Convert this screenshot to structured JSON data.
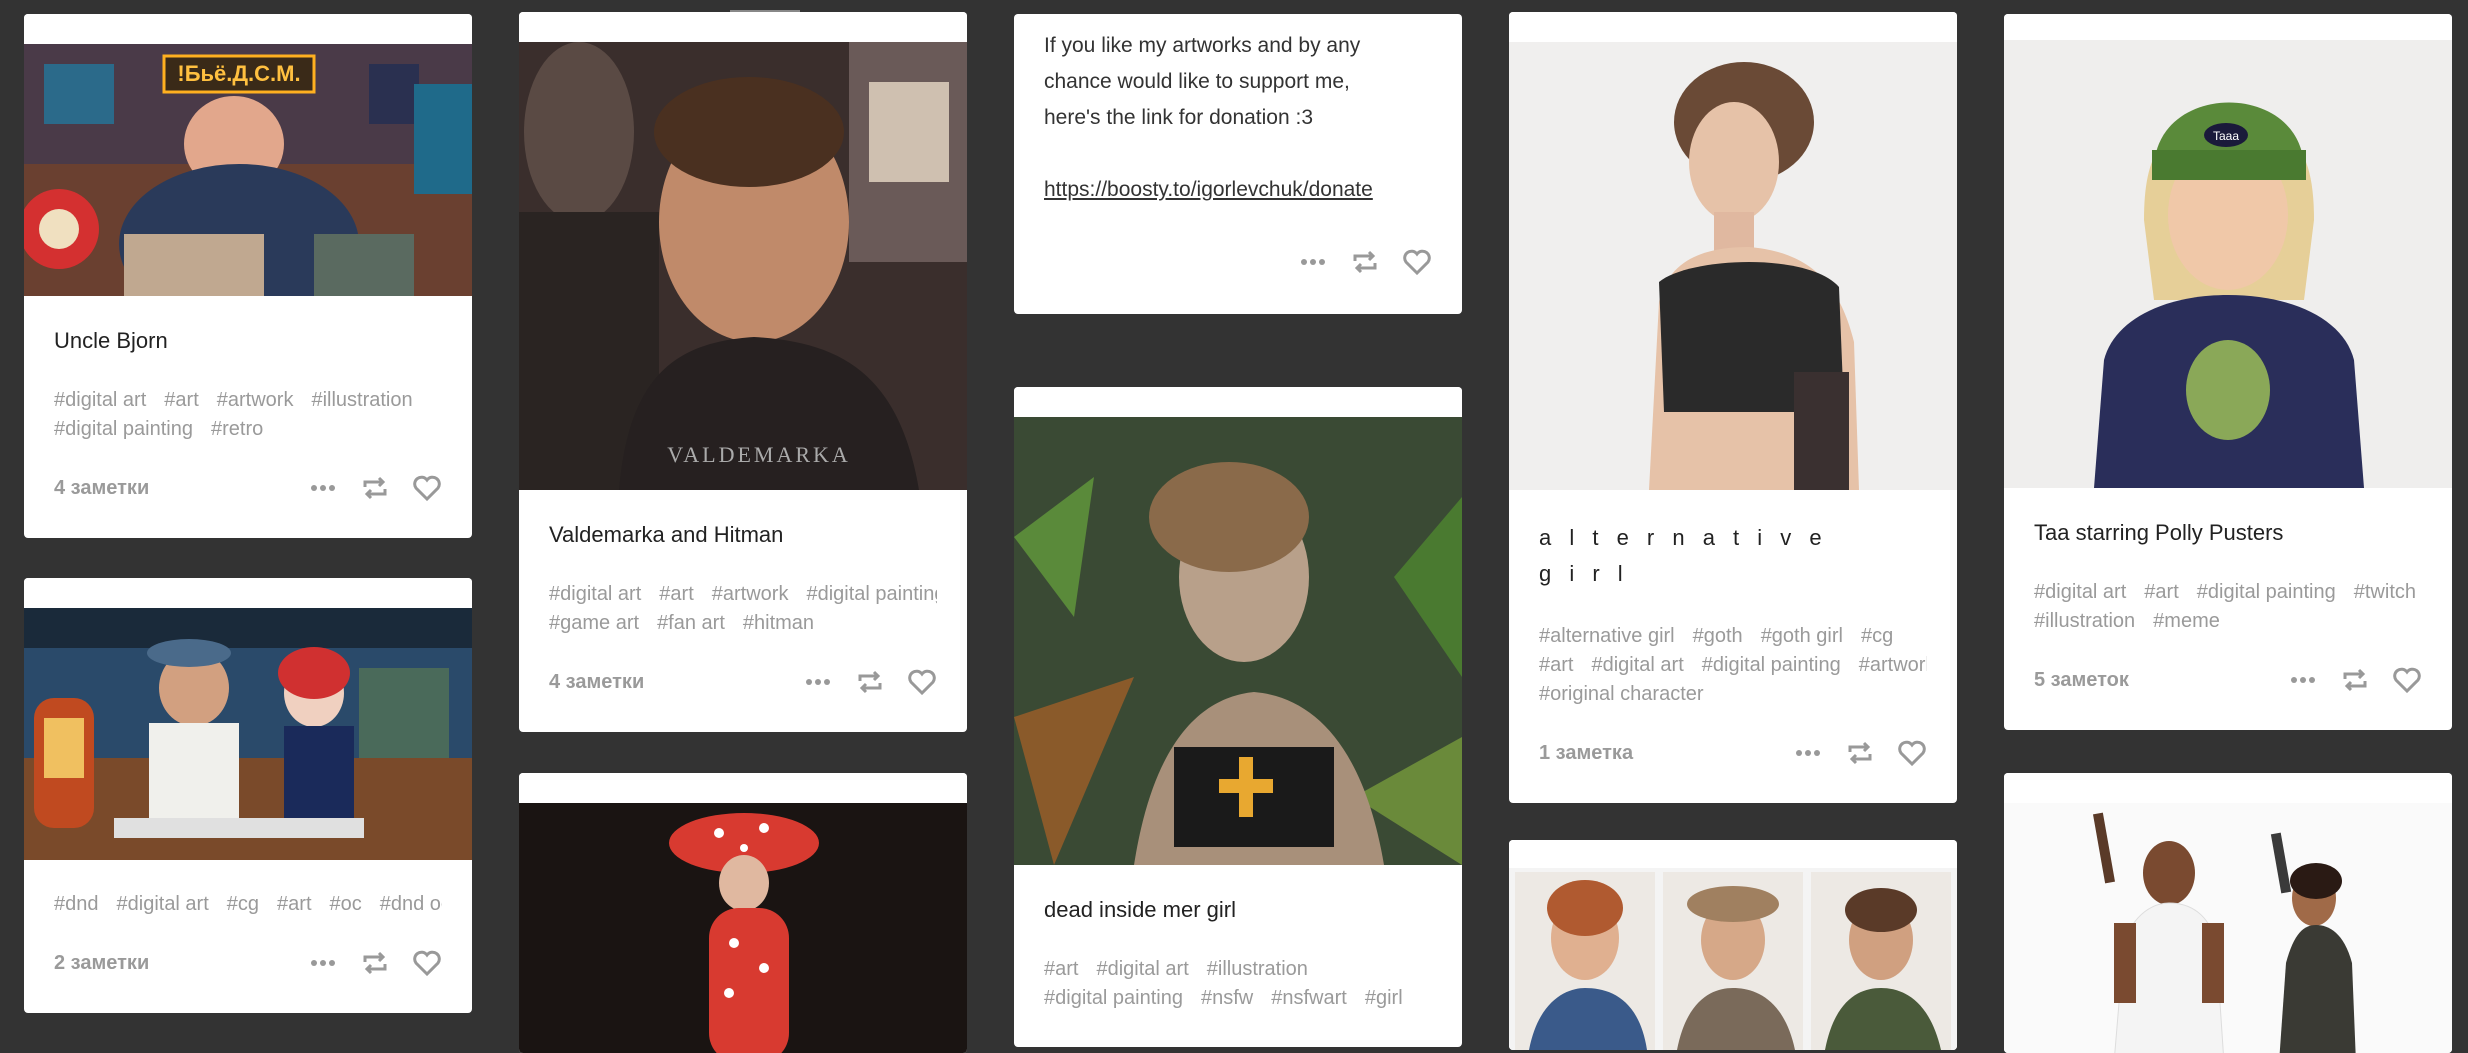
{
  "cards": {
    "uncle": {
      "title": "Uncle Bjorn",
      "sign_text": "!Бьё.Д.С.М.",
      "tags": [
        "#digital art",
        "#art",
        "#artwork",
        "#illustration"
      ],
      "tags2": [
        "#digital painting",
        "#retro"
      ],
      "notes": "4 заметки"
    },
    "dnd": {
      "tags": [
        "#dnd",
        "#digital art",
        "#cg",
        "#art",
        "#oc",
        "#dnd oc"
      ],
      "notes": "2 заметки"
    },
    "valdemarka": {
      "title": "Valdemarka and Hitman",
      "shirt_text": "VALDEMARKA",
      "tags": [
        "#digital art",
        "#art",
        "#artwork",
        "#digital painting"
      ],
      "tags2": [
        "#game art",
        "#fan art",
        "#hitman"
      ],
      "notes": "4 заметки"
    },
    "donation": {
      "text1": "If you like my artworks and by any",
      "text2": "chance would like to support me,",
      "text3": "here's the link for donation :3",
      "link": "https://boosty.to/igorlevchuk/donate"
    },
    "mermaid": {
      "title": "dead inside mer girl",
      "tags": [
        "#art",
        "#digital art",
        "#illustration"
      ],
      "tags2": [
        "#digital painting",
        "#nsfw",
        "#nsfwart",
        "#girl"
      ]
    },
    "altgirl": {
      "title": "a l t e r n a t i v e\ng i r l",
      "tags": [
        "#alternative girl",
        "#goth",
        "#goth girl",
        "#cg"
      ],
      "tags2": [
        "#art",
        "#digital art",
        "#digital painting",
        "#artwork"
      ],
      "tags3": [
        "#original character"
      ],
      "notes": "1 заметка"
    },
    "taa": {
      "title": "Taa starring Polly Pusters",
      "hat_text": "Taaa",
      "tags": [
        "#digital art",
        "#art",
        "#digital painting",
        "#twitch"
      ],
      "tags2": [
        "#illustration",
        "#meme"
      ],
      "notes": "5 заметок"
    }
  },
  "icons": {
    "more": "more-icon",
    "reblog": "reblog-icon",
    "like": "heart-icon"
  },
  "colors": {
    "background": "#333333",
    "card": "#ffffff",
    "tag": "#9a9a9a"
  }
}
